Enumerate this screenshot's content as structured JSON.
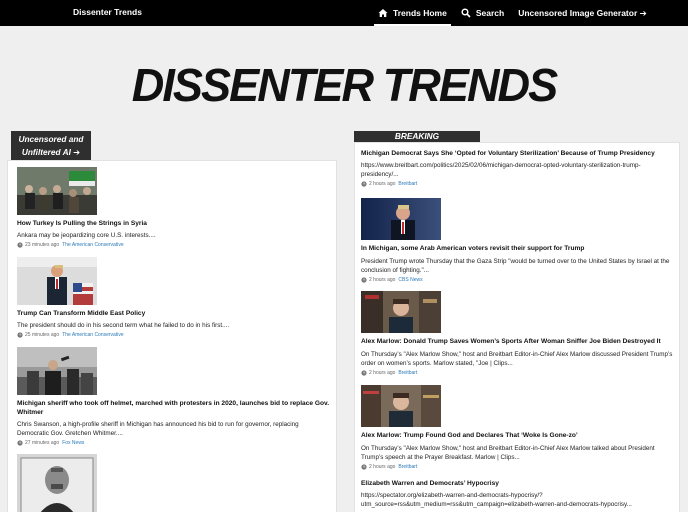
{
  "nav": {
    "brand": "Dissenter Trends",
    "home_label": "Trends Home",
    "search_label": "Search",
    "generator_label": "Uncensored Image Generator ➔"
  },
  "logo": {
    "text": "DISSENTER TRENDS"
  },
  "left": {
    "tag": "Uncensored and Unfiltered AI ➔",
    "articles": [
      {
        "title": "How Turkey Is Pulling the Strings in Syria",
        "description": "Ankara may be jeopardizing core U.S. interests....",
        "time": "23 minutes ago",
        "source": "The American Conservative"
      },
      {
        "title": "Trump Can Transform Middle East Policy",
        "description": "The president should do in his second term what he failed to do in his first....",
        "time": "25 minutes ago",
        "source": "The American Conservative"
      },
      {
        "title": "Michigan sheriff who took off helmet, marched with protesters in 2020, launches bid to replace Gov. Whitmer",
        "description": "Chris Swanson, a high-profile sheriff in Michigan has announced his bid to run for governor, replacing Democratic Gov. Gretchen Whitmer....",
        "time": "27 minutes ago",
        "source": "Fox News"
      }
    ]
  },
  "right": {
    "tag": "BREAKING",
    "items": [
      {
        "title": "Michigan Democrat Says She ‘Opted for Voluntary Sterilization’ Because of Trump Presidency",
        "description": "https://www.breitbart.com/politics/2025/02/06/michigan-democrat-opted-voluntary-sterilization-trump-presidency/...",
        "time": "2 hours ago",
        "source": "Breitbart"
      },
      {
        "title": "In Michigan, some Arab American voters revisit their support for Trump",
        "description": "President Trump wrote Thursday that the Gaza Strip \"would be turned over to the United States by Israel at the conclusion of fighting.\"...",
        "time": "2 hours ago",
        "source": "CBS News"
      },
      {
        "title": "Alex Marlow: Donald Trump Saves Women’s Sports After Woman Sniffer Joe Biden Destroyed It",
        "description": "On Thursday’s \"Alex Marlow Show,\" host and Breitbart Editor-in-Chief Alex Marlow discussed President Trump’s order on women’s sports. Marlow stated, \"Joe | Clips...",
        "time": "2 hours ago",
        "source": "Breitbart"
      },
      {
        "title": "Alex Marlow: Trump Found God and Declares That ‘Woke Is Gone-zo’",
        "description": "On Thursday’s \"Alex Marlow Show,\" host and Breitbart Editor-in-Chief Alex Marlow talked about President Trump’s speech at the Prayer Breakfast. Marlow | Clips...",
        "time": "2 hours ago",
        "source": "Breitbart"
      },
      {
        "title": "Elizabeth Warren and Democrats’ Hypocrisy",
        "description": "https://spectator.org/elizabeth-warren-and-democrats-hypocrisy/?utm_source=rss&utm_medium=rss&utm_campaign=elizabeth-warren-and-democrats-hypocrisy..."
      }
    ]
  },
  "colors": {
    "nav_bg": "#000000",
    "tag_bg": "#2f2f2f",
    "link": "#2a7ab8"
  }
}
